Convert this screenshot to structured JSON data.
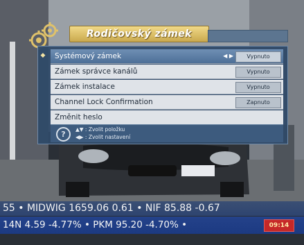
{
  "menu": {
    "title": "Rodičovský zámek",
    "items": [
      {
        "label": "Systémový zámek",
        "value": "Vypnuto",
        "selected": true,
        "arrows": "◀ ▶"
      },
      {
        "label": "Zámek správce kanálů",
        "value": "Vypnuto",
        "selected": false
      },
      {
        "label": "Zámek instalace",
        "value": "Vypnuto",
        "selected": false
      },
      {
        "label": "Channel Lock Confirmation",
        "value": "Zapnuto",
        "selected": false
      },
      {
        "label": "Změnit heslo",
        "value": "",
        "selected": false
      }
    ],
    "help": {
      "line1": "▲▼ : Zvolit položku",
      "line2": "◀▶ : Zvolit nastavení"
    },
    "accent_color": "#e0c26a",
    "panel_color": "#2f4a68"
  },
  "ticker": {
    "line1": "55 • MIDWIG 1659.06 0.61 • NIF 85.88 -0.67",
    "line2": "14N  4.59  -4.77% • PKM  95.20  -4.70% •",
    "time": "09:14"
  },
  "icons": {
    "header": "settings-gear-icon",
    "help": "question-circle-icon",
    "bullet": "diamond-bullet-icon"
  }
}
